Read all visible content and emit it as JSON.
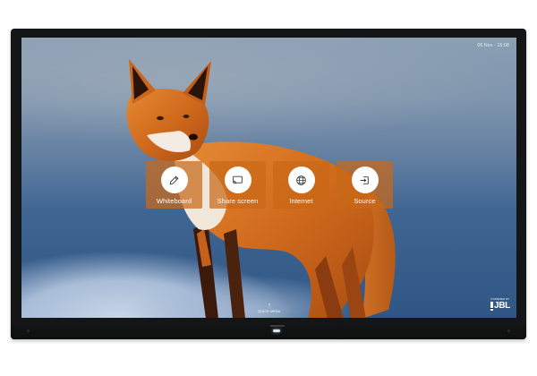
{
  "status": {
    "datetime": "06 Nov · 15:08"
  },
  "tiles": [
    {
      "label": "Whiteboard",
      "icon": "pencil-icon"
    },
    {
      "label": "Share screen",
      "icon": "cast-screen-icon"
    },
    {
      "label": "Internet",
      "icon": "globe-icon"
    },
    {
      "label": "Source",
      "icon": "input-source-icon"
    }
  ],
  "quick_menu": {
    "label": "QUICK MENU",
    "icon": "arrow-up-icon"
  },
  "branding": {
    "powered_by": "POWERED BY",
    "logo_text": "JBL"
  },
  "colors": {
    "tile_accent": "#c96818",
    "bezel": "#141516"
  }
}
